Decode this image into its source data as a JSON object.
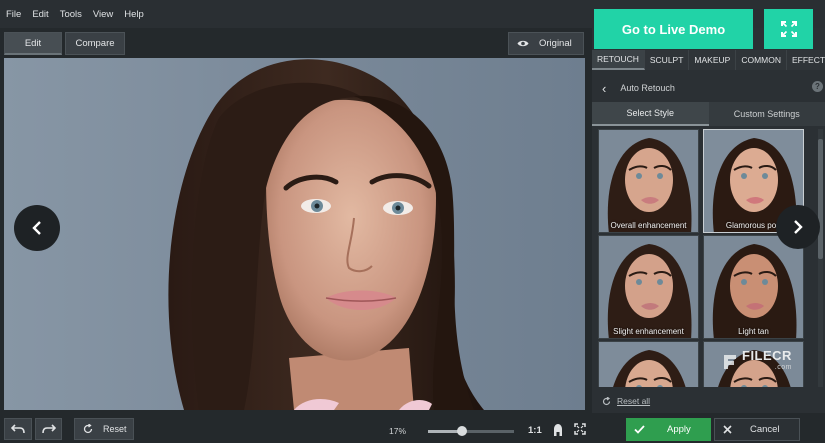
{
  "menu": [
    "File",
    "Edit",
    "Tools",
    "View",
    "Help"
  ],
  "toolbar": {
    "edit_label": "Edit",
    "compare_label": "Compare",
    "original_label": "Original"
  },
  "panel": {
    "categories": [
      "RETOUCH",
      "SCULPT",
      "MAKEUP",
      "COMMON",
      "EFFECTS"
    ],
    "active_category": "RETOUCH",
    "section_title": "Auto Retouch",
    "help": "?",
    "style_tabs": [
      "Select Style",
      "Custom Settings"
    ],
    "presets": [
      "Overall enhancement",
      "Glamorous port",
      "Slight enhancement",
      "Light tan",
      "",
      ""
    ],
    "reset_all": "Reset all"
  },
  "bottom": {
    "reset_label": "Reset",
    "zoom": "17%",
    "zoom_level": 0.4,
    "one_to_one": "1:1",
    "apply_label": "Apply",
    "cancel_label": "Cancel"
  },
  "overlay": {
    "live_demo": "Go to Live Demo",
    "watermark": "FILECR",
    "watermark_sub": ".com"
  },
  "colors": {
    "accent_green": "#21d3a7",
    "apply_green": "#2f9e4f"
  },
  "icons": {
    "prev": "chevron-left-icon",
    "next": "chevron-right-icon",
    "eye": "eye-icon",
    "expand": "expand-icon"
  }
}
